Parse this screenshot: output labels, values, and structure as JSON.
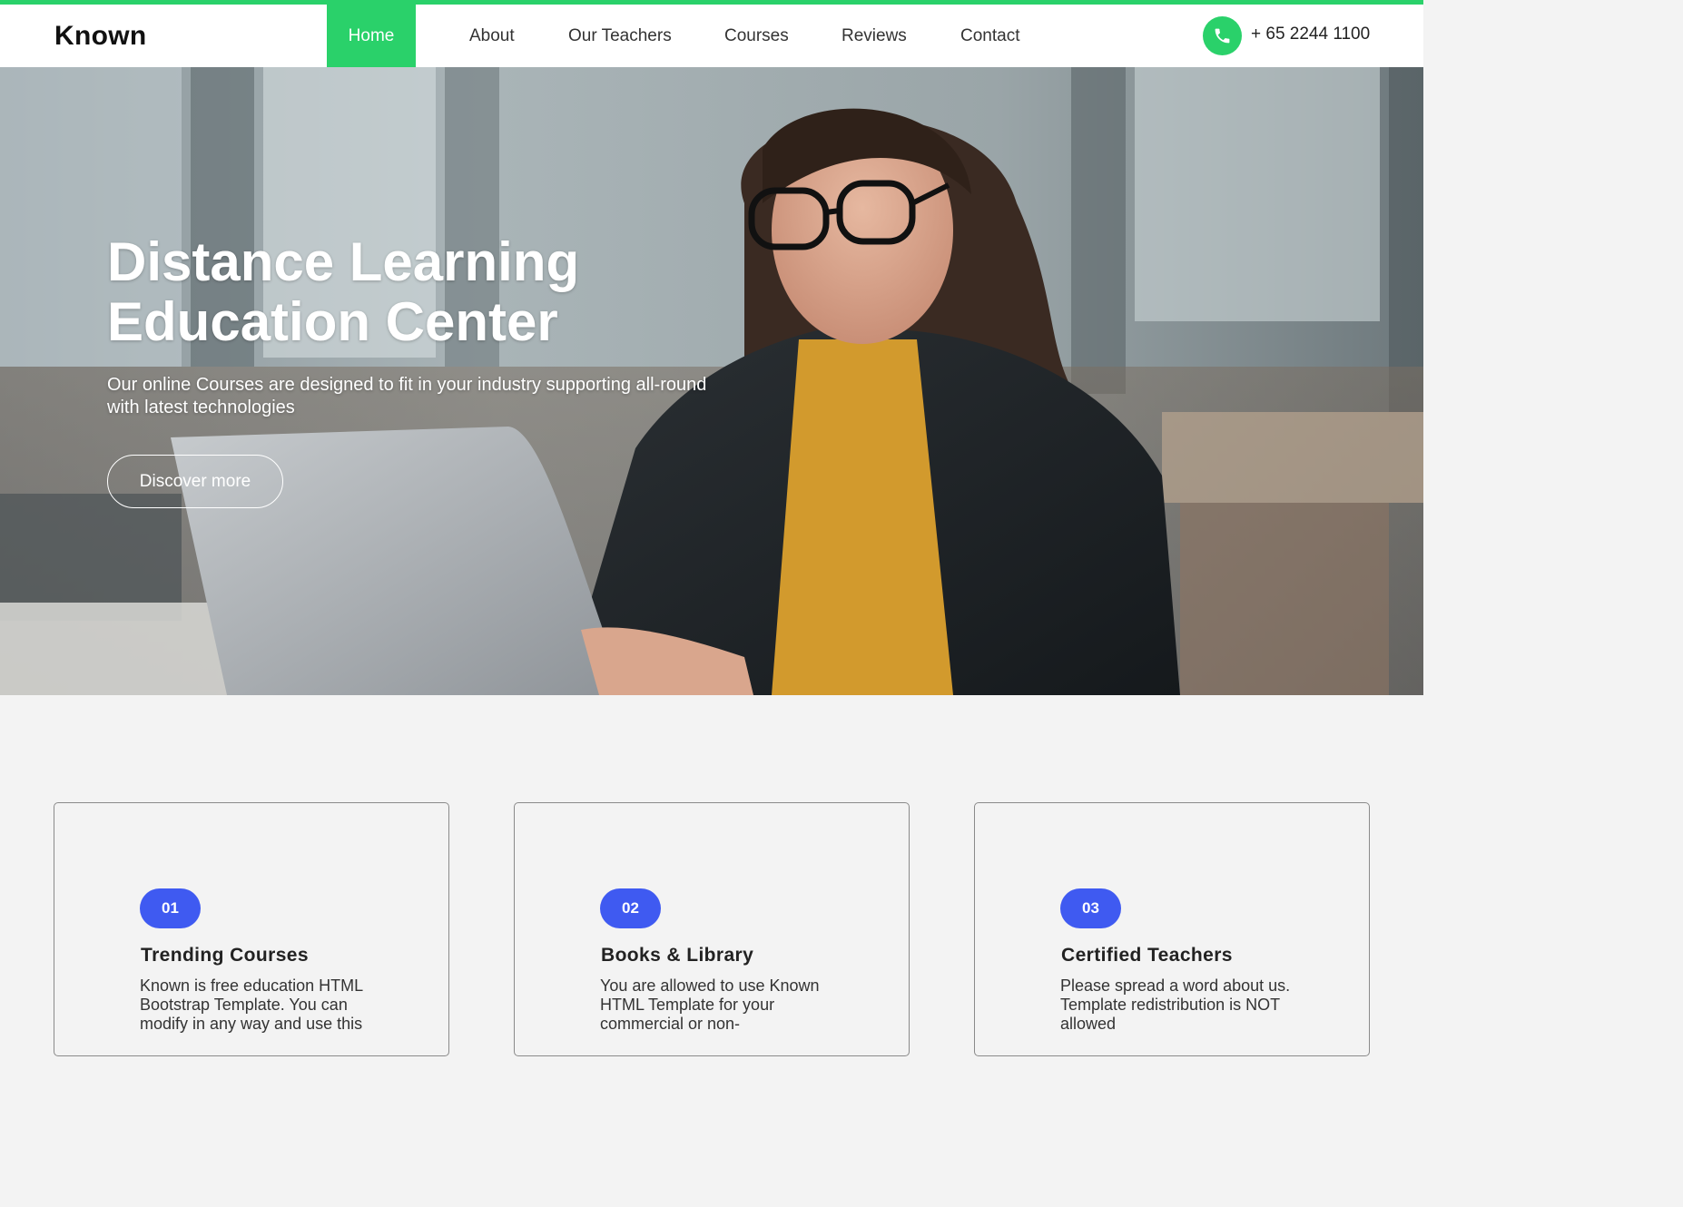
{
  "brand": {
    "name": "Known"
  },
  "nav": {
    "items": [
      {
        "label": "Home",
        "active": true
      },
      {
        "label": "About"
      },
      {
        "label": "Our Teachers"
      },
      {
        "label": "Courses"
      },
      {
        "label": "Reviews"
      },
      {
        "label": "Contact"
      }
    ],
    "phone": "+ 65 2244 1100"
  },
  "hero": {
    "title_line1": "Distance Learning",
    "title_line2": "Education Center",
    "text_line1": "Our online Courses are designed to fit in your industry supporting all-round",
    "text_line2": "with latest technologies",
    "button": "Discover more"
  },
  "features": [
    {
      "number": "01",
      "title": "Trending Courses",
      "text": "Known is free education HTML Bootstrap Template. You can modify in any way and use this"
    },
    {
      "number": "02",
      "title": "Books & Library",
      "text": "You are allowed to use Known HTML Template for your commercial or non-"
    },
    {
      "number": "03",
      "title": "Certified Teachers",
      "text": "Please spread a word about us. Template redistribution is NOT allowed"
    }
  ],
  "colors": {
    "accent": "#2ad16a",
    "badge": "#3f5af1"
  }
}
